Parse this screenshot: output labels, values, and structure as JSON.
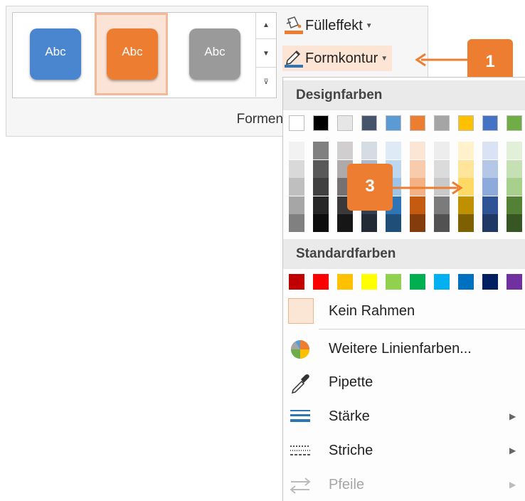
{
  "ribbon": {
    "gallery_styles": [
      {
        "label": "Abc",
        "color": "#4a86d0"
      },
      {
        "label": "Abc",
        "color": "#ed7d31"
      },
      {
        "label": "Abc",
        "color": "#9a9a9a"
      }
    ],
    "group_label": "Formenarten",
    "fill_effect_label": "Fülleffekt",
    "outline_label": "Formkontur"
  },
  "callouts": {
    "one": "1",
    "three": "3"
  },
  "menu": {
    "design_colors_header": "Designfarben",
    "theme_colors": [
      "#ffffff",
      "#000000",
      "#e7e6e6",
      "#44546a",
      "#5b9bd5",
      "#ed7d31",
      "#a5a5a5",
      "#ffc000",
      "#4472c4",
      "#70ad47"
    ],
    "shades": [
      [
        "#f2f2f2",
        "#d9d9d9",
        "#bfbfbf",
        "#a6a6a6",
        "#808080"
      ],
      [
        "#808080",
        "#595959",
        "#404040",
        "#262626",
        "#0d0d0d"
      ],
      [
        "#d0cece",
        "#aeaaaa",
        "#757171",
        "#3a3838",
        "#171616"
      ],
      [
        "#d6dce4",
        "#adb9ca",
        "#8496b0",
        "#333f4f",
        "#222a35"
      ],
      [
        "#deebf6",
        "#bdd7ee",
        "#9dc3e6",
        "#2e75b5",
        "#1f4e79"
      ],
      [
        "#fbe5d5",
        "#f7cbac",
        "#f4b183",
        "#c55a11",
        "#843c0c"
      ],
      [
        "#ededed",
        "#dbdbdb",
        "#c9c9c9",
        "#7b7b7b",
        "#525252"
      ],
      [
        "#fff2cc",
        "#fee599",
        "#ffd966",
        "#bf9000",
        "#7f6000"
      ],
      [
        "#dae3f3",
        "#b4c7e7",
        "#8eaadb",
        "#2f5496",
        "#1f3864"
      ],
      [
        "#e2efd9",
        "#c5e0b3",
        "#a8d08d",
        "#538135",
        "#375623"
      ]
    ],
    "standard_colors_header": "Standardfarben",
    "standard_colors": [
      "#c00000",
      "#ff0000",
      "#ffc000",
      "#ffff00",
      "#92d050",
      "#00b050",
      "#00b0f0",
      "#0070c0",
      "#002060",
      "#7030a0"
    ],
    "no_outline_label": "Kein Rahmen",
    "more_colors_label": "Weitere Linienfarben...",
    "eyedropper_label": "Pipette",
    "weight_label": "Stärke",
    "dashes_label": "Striche",
    "arrows_label": "Pfeile"
  }
}
